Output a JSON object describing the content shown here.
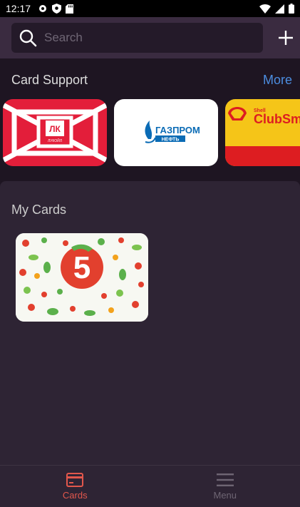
{
  "status_bar": {
    "time": "12:17",
    "icons": [
      "settings-icon",
      "shield-icon",
      "sd-card-icon"
    ],
    "right_icons": [
      "wifi-icon",
      "signal-icon",
      "battery-icon"
    ]
  },
  "search": {
    "placeholder": "Search",
    "value": ""
  },
  "support": {
    "title": "Card Support",
    "more_label": "More",
    "cards": [
      {
        "brand": "lukoil",
        "logo_text": "ЛУКОЙЛ",
        "color": "#e31e3a"
      },
      {
        "brand": "gazprom",
        "logo_text": "ГАЗПРОМ",
        "sub_text": "НЕФТЬ",
        "color": "#ffffff"
      },
      {
        "brand": "shell",
        "logo_text": "ClubSm",
        "small_text": "Shell",
        "color": "#f5c518"
      }
    ]
  },
  "my_cards": {
    "title": "My Cards",
    "cards": [
      {
        "brand": "pyaterochka",
        "logo_text": "5",
        "color": "#e2402e"
      }
    ]
  },
  "bottom_nav": {
    "items": [
      {
        "label": "Cards",
        "active": true
      },
      {
        "label": "Menu",
        "active": false
      }
    ]
  },
  "colors": {
    "accent": "#e2574c",
    "link": "#4c8de0"
  }
}
